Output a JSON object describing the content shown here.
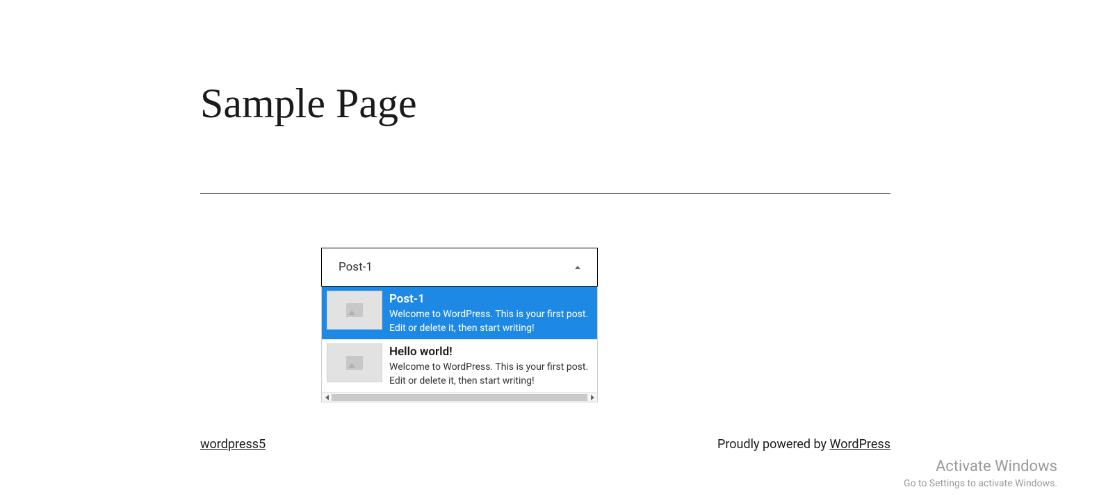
{
  "page": {
    "title": "Sample Page"
  },
  "dropdown": {
    "selected_value": "Post-1",
    "items": [
      {
        "title": "Post-1",
        "description": "Welcome to WordPress. This is your first post. Edit or delete it, then start writing!",
        "selected": true
      },
      {
        "title": "Hello world!",
        "description": "Welcome to WordPress. This is your first post. Edit or delete it, then start writing!",
        "selected": false
      }
    ]
  },
  "footer": {
    "site_link": "wordpress5",
    "powered_prefix": "Proudly powered by ",
    "powered_link": "WordPress"
  },
  "watermark": {
    "title": "Activate Windows",
    "subtitle": "Go to Settings to activate Windows."
  }
}
